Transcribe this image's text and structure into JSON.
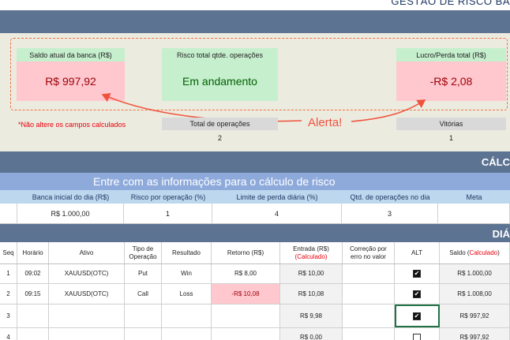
{
  "sheet_title": "GESTÃO DE RISCO BA",
  "cards": {
    "saldo_label": "Saldo atual da banca (R$)",
    "saldo_value": "R$ 997,92",
    "risco_label": "Risco total qtde. operações",
    "risco_value": "Em andamento",
    "lucro_label": "Lucro/Perda total (R$)",
    "lucro_value": "-R$ 2,08"
  },
  "warning": "*Não altere os campos calculados",
  "alert": "Alerta!",
  "totals": {
    "ops_label": "Total de operações",
    "ops_value": "2",
    "wins_label": "Vitórias",
    "wins_value": "1"
  },
  "calc_section_title": "CÁLC",
  "info": {
    "heading": "Entre com as informações para o cálculo de risco",
    "columns": [
      "Banca inicial do dia (R$)",
      "Risco por operação (%)",
      "Limite de perda diária (%)",
      "Qtd. de operações no dia",
      "Meta"
    ],
    "values": [
      "R$ 1.000,00",
      "1",
      "4",
      "3",
      ""
    ]
  },
  "day_section_title": "DIÁ",
  "day_table": {
    "headers": {
      "seq": "Seq",
      "horario": "Horário",
      "ativo": "Ativo",
      "tipo_1": "Tipo de",
      "tipo_2": "Operação",
      "resultado": "Resultado",
      "retorno": "Retorno (R$)",
      "entrada_1": "Entrada (R$)",
      "entrada_2": "(Calculado)",
      "correcao_1": "Correção por",
      "correcao_2": "erro no valor",
      "alt": "ALT",
      "saldo_1": "Saldo (",
      "saldo_2": "Calculado",
      "saldo_3": ")"
    },
    "rows": [
      {
        "seq": "1",
        "horario": "09:02",
        "ativo": "XAUUSD(OTC)",
        "tipo": "Put",
        "resultado": "Win",
        "retorno": "R$ 8,00",
        "entrada": "R$ 10,00",
        "alt": "✔",
        "saldo": "R$ 1.000,00"
      },
      {
        "seq": "2",
        "horario": "09:15",
        "ativo": "XAUUSD(OTC)",
        "tipo": "Call",
        "resultado": "Loss",
        "retorno": "-R$ 10,08",
        "entrada": "R$ 10,08",
        "alt": "✔",
        "saldo": "R$ 1.008,00"
      },
      {
        "seq": "3",
        "horario": "",
        "ativo": "",
        "tipo": "",
        "resultado": "",
        "retorno": "",
        "entrada": "R$ 9,98",
        "alt": "✔",
        "saldo": "R$ 997,92"
      },
      {
        "seq": "4",
        "horario": "",
        "ativo": "",
        "tipo": "",
        "resultado": "",
        "retorno": "",
        "entrada": "R$ 0,00",
        "alt": "",
        "saldo": "R$ 997,92"
      }
    ]
  },
  "colors": {
    "band": "#5d7392",
    "beige": "#ecebe0",
    "pink_fill": "#ffc7ce",
    "pink_text": "#9c0006",
    "green_fill": "#c6efce",
    "green_text": "#006100",
    "alert": "#f0523c"
  }
}
